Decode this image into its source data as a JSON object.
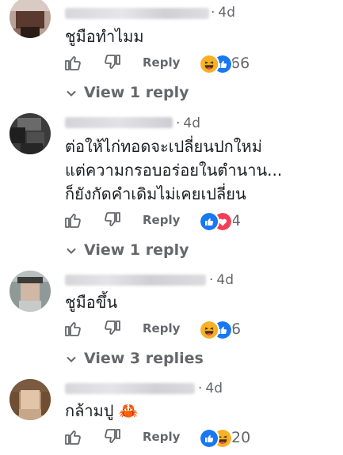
{
  "comments": [
    {
      "time": "4d",
      "text": "ชูมือทำไมม",
      "reply_label": "Reply",
      "reactions": [
        "haha-icon",
        "like-icon"
      ],
      "reaction_count": "66",
      "view_replies": "View 1 reply"
    },
    {
      "time": "4d",
      "text": "ต่อให้ไก่ทอดจะเปลี่ยนปกใหม่\nแต่ความกรอบอร่อยในตำนาน...\nก็ยังกัดคำเดิมไม่เคยเปลี่ยน",
      "reply_label": "Reply",
      "reactions": [
        "like-icon",
        "love-icon"
      ],
      "reaction_count": "4",
      "view_replies": "View 1 reply"
    },
    {
      "time": "4d",
      "text": "ชูมือขึ้น",
      "reply_label": "Reply",
      "reactions": [
        "haha-icon",
        "like-icon"
      ],
      "reaction_count": "6",
      "view_replies": "View 3 replies"
    },
    {
      "time": "4d",
      "text": "กล้ามปู 🦀",
      "reply_label": "Reply",
      "reactions": [
        "like-icon",
        "haha-icon"
      ],
      "reaction_count": "20"
    }
  ],
  "colors": {
    "like": "#1877f2",
    "love": "#f33e58",
    "haha": "#f7b125",
    "meta_text": "#65676b",
    "body_text": "#1c1e21"
  }
}
